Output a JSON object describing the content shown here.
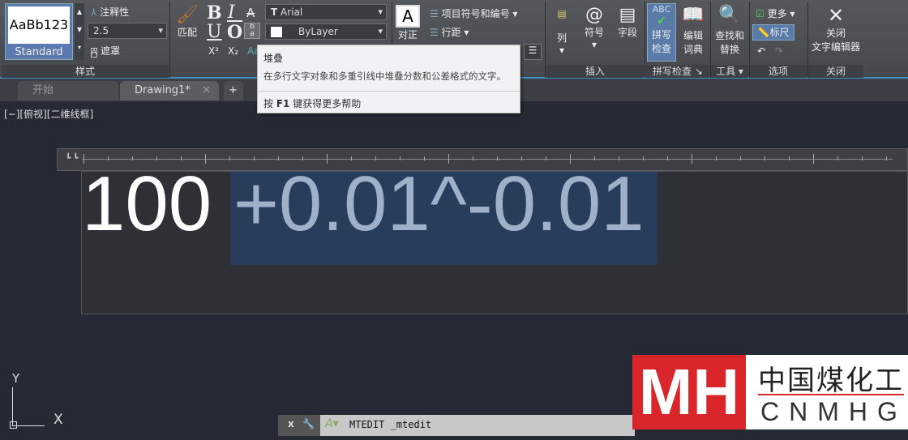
{
  "ribbon": {
    "style": {
      "preview": "AaBb123",
      "name": "Standard",
      "annotative": "注释性",
      "height": "2.5",
      "mask": "遮罩",
      "panel": "样式"
    },
    "format": {
      "match": "匹配",
      "bold": "B",
      "italic": "I",
      "underline": "U",
      "overline": "O",
      "superscript": "X²",
      "subscript": "X₂",
      "font": "Arial",
      "color": "ByLayer"
    },
    "paragraph": {
      "justify": "对正",
      "bullets": "项目符号和编号",
      "spacing": "行距"
    },
    "insert": {
      "columns": "列",
      "symbol": "符号",
      "field": "字段",
      "panel": "插入"
    },
    "spell": {
      "check": "拼写检查",
      "check_l1": "拼写",
      "check_l2": "检查",
      "dict_l1": "编辑",
      "dict_l2": "词典",
      "panel": "拼写检查"
    },
    "tools": {
      "find_l1": "查找和",
      "find_l2": "替换",
      "panel": "工具"
    },
    "options": {
      "more": "更多",
      "ruler": "标尺",
      "panel": "选项"
    },
    "close": {
      "l1": "关闭",
      "l2": "文字编辑器",
      "panel": "关闭"
    }
  },
  "tabs": [
    {
      "label": "开始"
    },
    {
      "label": "Drawing1*"
    }
  ],
  "tooltip": {
    "title": "堆叠",
    "desc": "在多行文字对象和多重引线中堆叠分数和公差格式的文字。",
    "help_pre": "按 ",
    "help_key": "F1",
    "help_post": " 键获得更多帮助"
  },
  "viewport_label": "[−][俯视][二维线框]",
  "editor": {
    "text": "100 ",
    "selected": "+0.01^-0.01"
  },
  "ucs": {
    "x": "X",
    "y": "Y"
  },
  "command": {
    "text": "MTEDIT _mtedit"
  },
  "watermark": {
    "cn": "中国煤化工",
    "en": "CNMHG"
  }
}
